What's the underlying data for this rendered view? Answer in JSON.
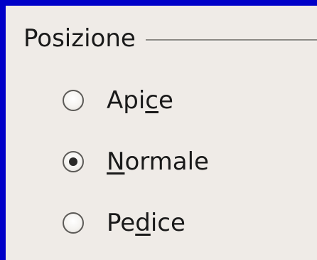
{
  "group": {
    "title": "Posizione"
  },
  "options": [
    {
      "pre": "Api",
      "mnemonic": "c",
      "post": "e",
      "checked": false
    },
    {
      "pre": "",
      "mnemonic": "N",
      "post": "ormale",
      "checked": true
    },
    {
      "pre": "Pe",
      "mnemonic": "d",
      "post": "ice",
      "checked": false
    }
  ],
  "colors": {
    "window_border": "#0000c8",
    "panel_background": "#efebe7"
  },
  "icons": {
    "radio": "radio-button-icon"
  }
}
